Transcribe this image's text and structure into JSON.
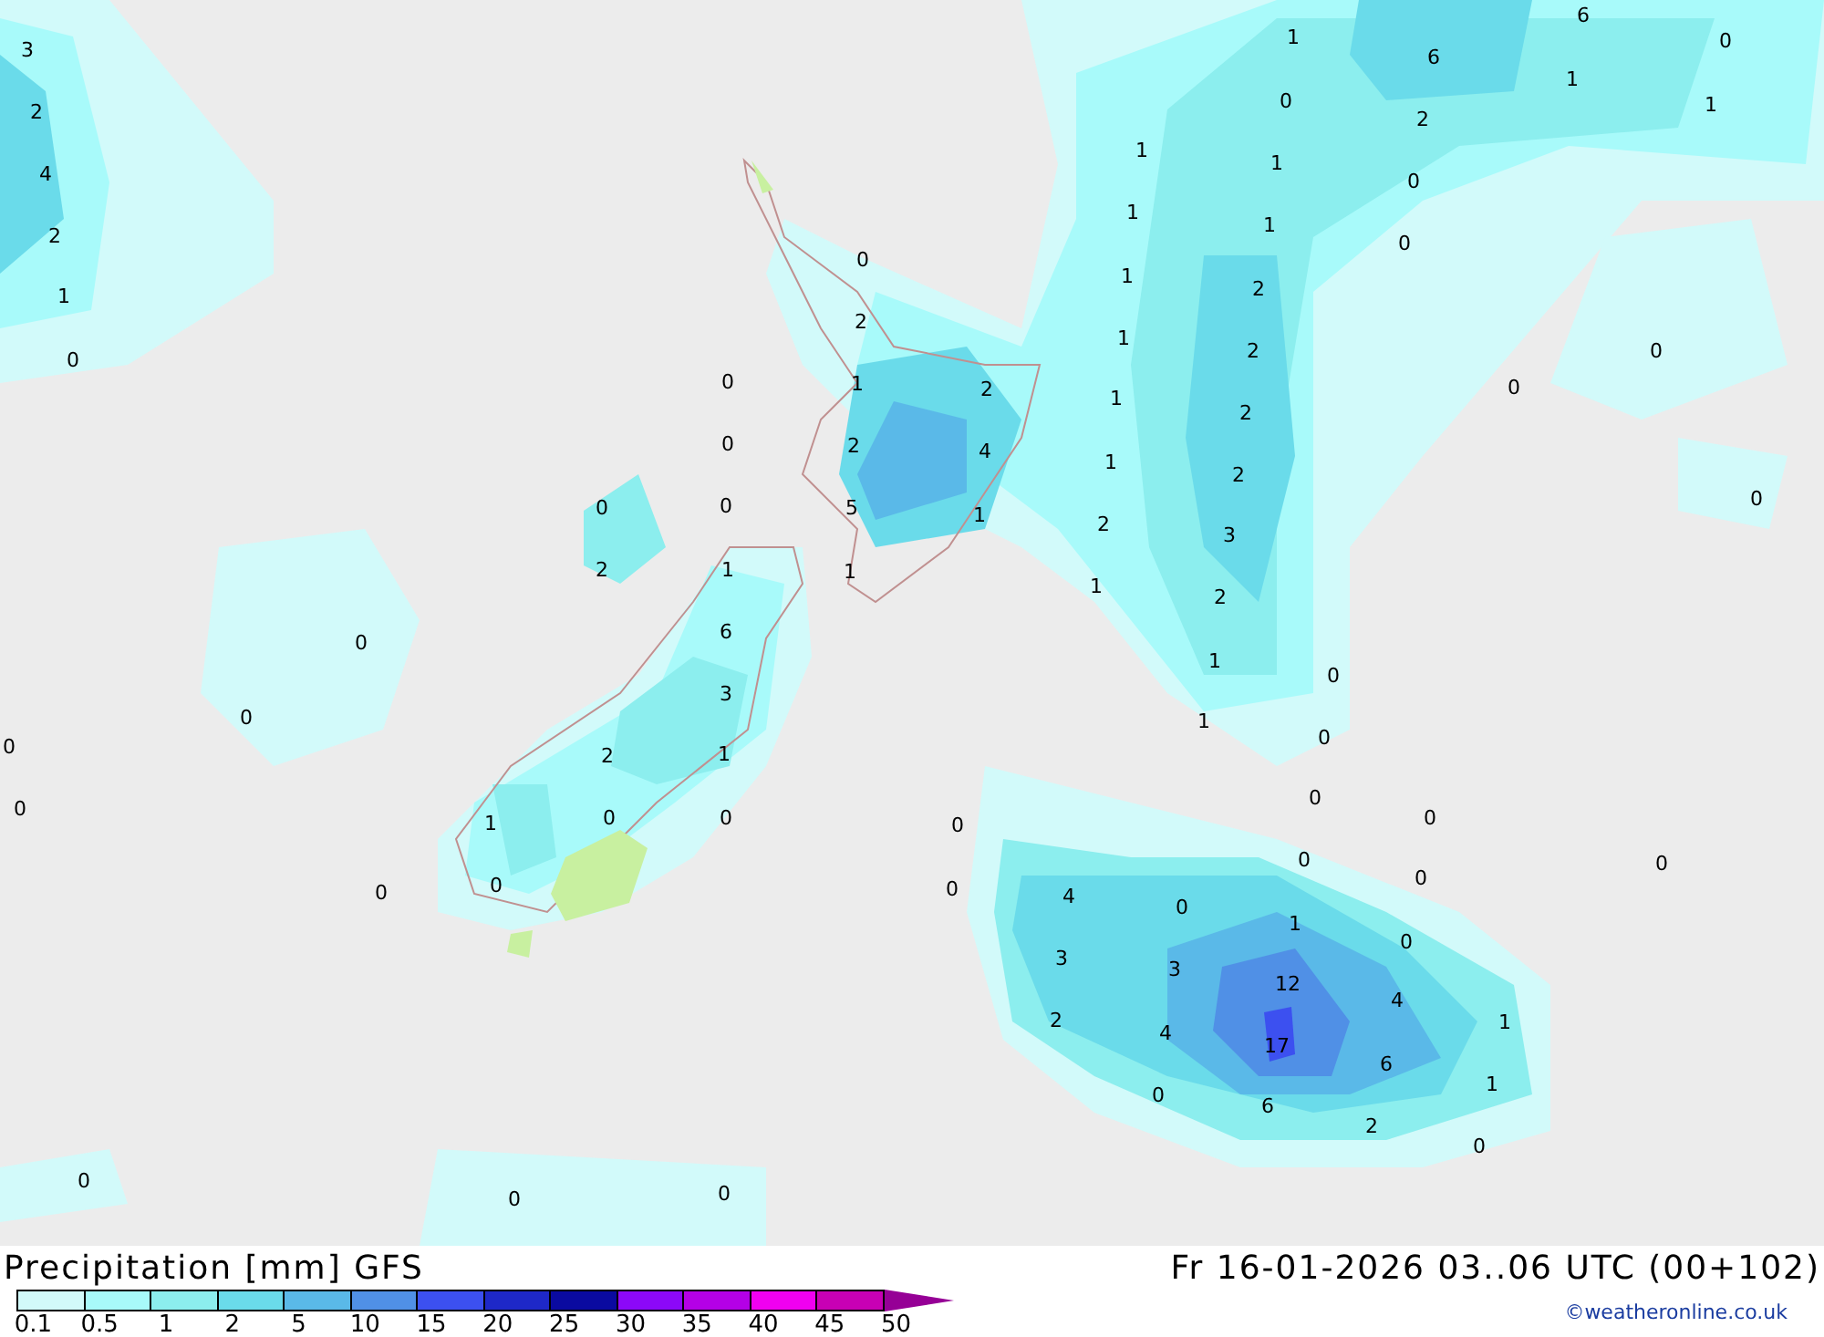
{
  "map": {
    "labels": [
      "3",
      "2",
      "4",
      "2",
      "1",
      "0",
      "1",
      "6",
      "6",
      "0",
      "1",
      "0",
      "1",
      "2",
      "1",
      "1",
      "0",
      "1",
      "1",
      "0",
      "0",
      "1",
      "2",
      "2",
      "1",
      "2",
      "0",
      "0",
      "1",
      "2",
      "1",
      "2",
      "0",
      "0",
      "2",
      "4",
      "1",
      "2",
      "0",
      "0",
      "0",
      "5",
      "1",
      "2",
      "3",
      "2",
      "1",
      "1",
      "1",
      "2",
      "6",
      "0",
      "1",
      "0",
      "3",
      "0",
      "1",
      "0",
      "0",
      "2",
      "1",
      "0",
      "0",
      "1",
      "0",
      "0",
      "0",
      "0",
      "0",
      "0",
      "0",
      "0",
      "0",
      "0",
      "4",
      "0",
      "1",
      "0",
      "3",
      "3",
      "12",
      "4",
      "2",
      "4",
      "17",
      "1",
      "6",
      "0",
      "6",
      "1",
      "2",
      "0",
      "0",
      "0",
      "0"
    ]
  },
  "footer": {
    "title": "Precipitation [mm] GFS",
    "valid_time": "Fr 16-01-2026 03..06 UTC (00+102)",
    "credit": "©weatheronline.co.uk"
  },
  "legend": {
    "swatches": [
      {
        "kind": "box",
        "color": "#d2fafa"
      },
      {
        "kind": "box",
        "color": "#a8fafa"
      },
      {
        "kind": "box",
        "color": "#8ceeee"
      },
      {
        "kind": "box",
        "color": "#6adbea"
      },
      {
        "kind": "box",
        "color": "#5ab9e8"
      },
      {
        "kind": "box",
        "color": "#5090e6"
      },
      {
        "kind": "box",
        "color": "#3c50f0"
      },
      {
        "kind": "box",
        "color": "#1e28c8"
      },
      {
        "kind": "box",
        "color": "#0a0aa0"
      },
      {
        "kind": "box",
        "color": "#8c08f8"
      },
      {
        "kind": "box",
        "color": "#b400e6"
      },
      {
        "kind": "box",
        "color": "#f000f0"
      },
      {
        "kind": "box",
        "color": "#c800b4"
      },
      {
        "kind": "arrow",
        "color": "#960096"
      }
    ],
    "labels": [
      "0.1",
      "0.5",
      "1",
      "2",
      "5",
      "10",
      "15",
      "20",
      "25",
      "30",
      "35",
      "40",
      "45",
      "50"
    ]
  }
}
